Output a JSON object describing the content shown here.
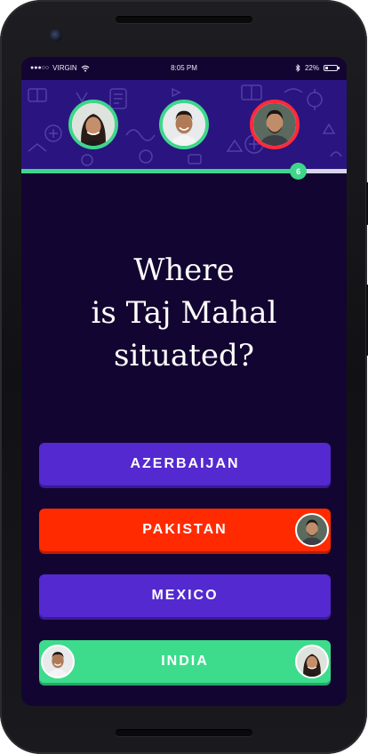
{
  "status_bar": {
    "signal": "●●●○○",
    "carrier": "VIRGIN",
    "time": "8:05 PM",
    "battery": "22%",
    "battery_level": 0.22
  },
  "players": [
    {
      "name": "player-woman",
      "ring_color": "#3ed68a"
    },
    {
      "name": "player-man-smiling",
      "ring_color": "#3ed68a"
    },
    {
      "name": "player-man-bearded",
      "ring_color": "#ff2a3a"
    }
  ],
  "progress": {
    "fraction": 0.85,
    "count": "6"
  },
  "question": {
    "lines": [
      "Where",
      "is Taj Mahal",
      "situated?"
    ]
  },
  "answers": [
    {
      "label": "AZERBAIJAN",
      "state": "default"
    },
    {
      "label": "PAKISTAN",
      "state": "wrong"
    },
    {
      "label": "MEXICO",
      "state": "default"
    },
    {
      "label": "INDIA",
      "state": "correct"
    }
  ],
  "colors": {
    "background": "#130531",
    "header": "#2a1480",
    "answer_default": "#5429cf",
    "answer_wrong": "#ff2a00",
    "answer_correct": "#3ddc8c",
    "progress": "#3ed68a"
  }
}
